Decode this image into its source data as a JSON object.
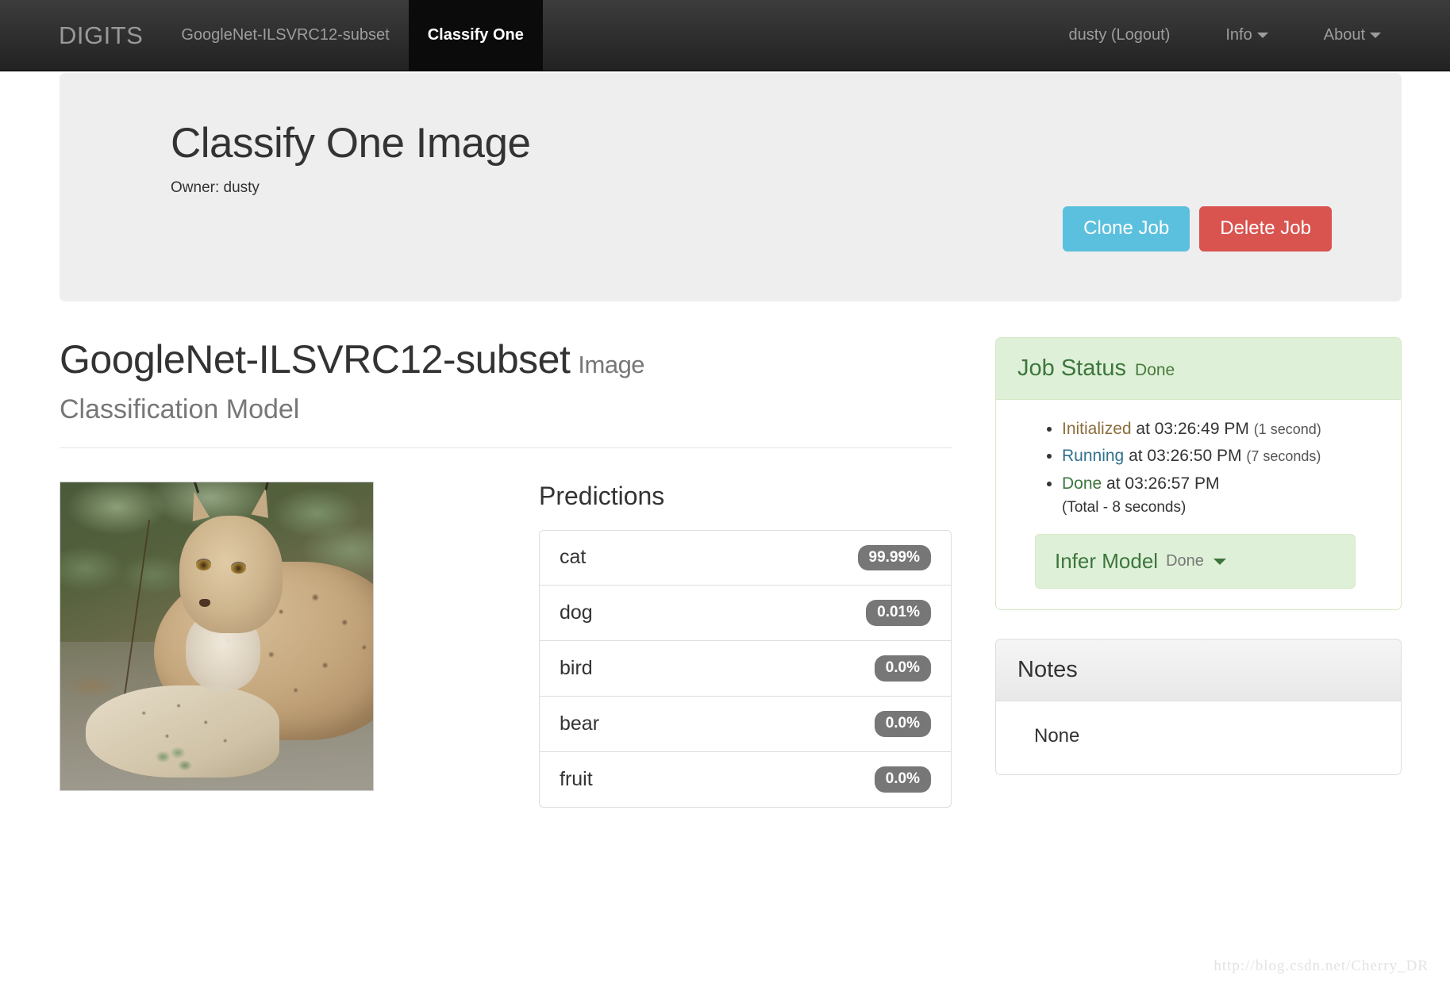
{
  "navbar": {
    "brand": "DIGITS",
    "left_items": [
      {
        "label": "GoogleNet-ILSVRC12-subset",
        "active": false
      },
      {
        "label": "Classify One",
        "active": true
      }
    ],
    "right_items": [
      {
        "label": "dusty (Logout)",
        "caret": false
      },
      {
        "label": "Info",
        "caret": true
      },
      {
        "label": "About",
        "caret": true
      }
    ]
  },
  "jumbotron": {
    "title": "Classify One Image",
    "owner": "Owner: dusty",
    "clone_label": "Clone Job",
    "delete_label": "Delete Job",
    "clone_color": "#5bc0de",
    "delete_color": "#d9534f"
  },
  "model": {
    "name": "GoogleNet-ILSVRC12-subset",
    "type_label": "Image",
    "subtitle": "Classification Model"
  },
  "predictions": {
    "heading": "Predictions",
    "rows": [
      {
        "label": "cat",
        "value": "99.99%"
      },
      {
        "label": "dog",
        "value": "0.01%"
      },
      {
        "label": "bird",
        "value": "0.0%"
      },
      {
        "label": "bear",
        "value": "0.0%"
      },
      {
        "label": "fruit",
        "value": "0.0%"
      }
    ],
    "badge_color": "#777777"
  },
  "job_status": {
    "title": "Job Status",
    "status": "Done",
    "events": [
      {
        "state": "Initialized",
        "state_color": "#8a6d3b",
        "at": "at 03:26:49 PM",
        "duration": "(1 second)"
      },
      {
        "state": "Running",
        "state_color": "#31708f",
        "at": "at 03:26:50 PM",
        "duration": "(7 seconds)"
      },
      {
        "state": "Done",
        "state_color": "#3c763d",
        "at": "at 03:26:57 PM",
        "duration": ""
      }
    ],
    "total": "(Total - 8 seconds)",
    "subtask": {
      "title": "Infer Model",
      "status": "Done",
      "icon": "caret-down-icon"
    }
  },
  "notes": {
    "title": "Notes",
    "body": "None"
  },
  "watermark": "http://blog.csdn.net/Cherry_DR"
}
